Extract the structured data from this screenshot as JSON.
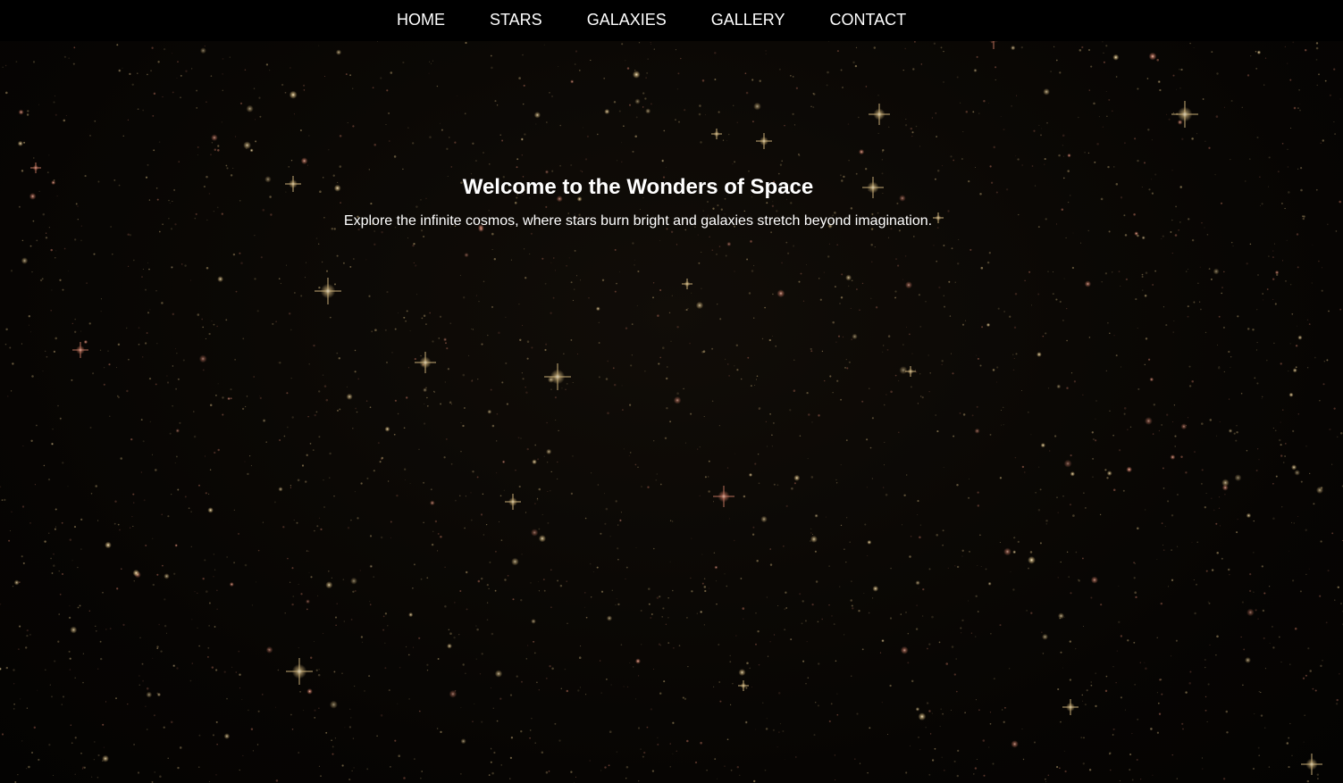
{
  "nav": {
    "items": [
      {
        "label": "HOME"
      },
      {
        "label": "STARS"
      },
      {
        "label": "GALAXIES"
      },
      {
        "label": "GALLERY"
      },
      {
        "label": "CONTACT"
      }
    ]
  },
  "hero": {
    "title": "Welcome to the Wonders of Space",
    "subtitle": "Explore the infinite cosmos, where stars burn bright and galaxies stretch beyond imagination."
  },
  "colors": {
    "background": "#080604",
    "navbar": "#000000",
    "text": "#ffffff",
    "star_warm": "#e8c98a",
    "star_red": "#d9826a"
  }
}
